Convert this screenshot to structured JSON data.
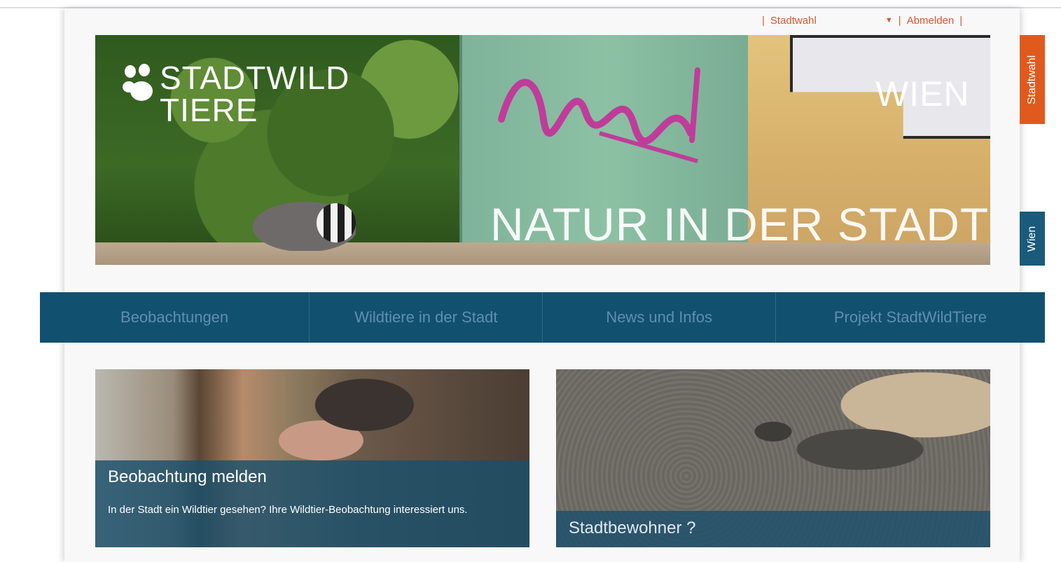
{
  "topnav": {
    "city_select_label": "Stadtwahl",
    "logout_label": "Abmelden",
    "separator": "|"
  },
  "brand": {
    "line1": "STADTWILD",
    "line2": "TIERE"
  },
  "hero": {
    "city": "WIEN",
    "slogan": "NATUR IN DER STADT"
  },
  "side_tabs": {
    "city_select": "Stadtwahl",
    "current_city": "Wien"
  },
  "mainnav": {
    "items": [
      "Beobachtungen",
      "Wildtiere in der Stadt",
      "News und Infos",
      "Projekt StadtWildTiere"
    ]
  },
  "cards": [
    {
      "title": "Beobachtung melden",
      "description": "In der Stadt ein Wildtier gesehen? Ihre Wildtier-Beobachtung interessiert uns."
    },
    {
      "title": "Stadtbewohner ?"
    }
  ],
  "colors": {
    "accent_orange": "#e05a1e",
    "nav_blue": "#12506f",
    "nav_text": "#5f8fb0"
  }
}
